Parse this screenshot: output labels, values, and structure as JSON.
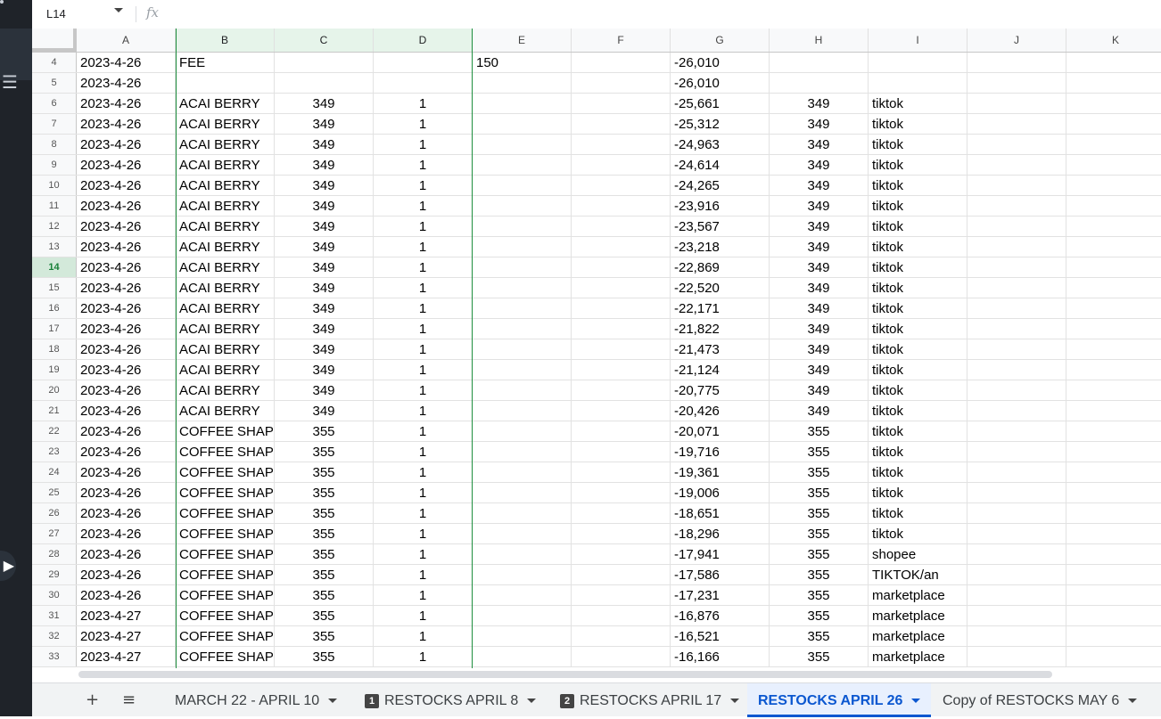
{
  "formula_bar": {
    "cell_ref": "L14",
    "fx_label": "fx"
  },
  "columns": [
    "A",
    "B",
    "C",
    "D",
    "E",
    "F",
    "G",
    "H",
    "I",
    "J",
    "K"
  ],
  "selected_columns": [
    "B",
    "C",
    "D"
  ],
  "selected_row": "14",
  "rows": [
    {
      "n": "4",
      "A": "2023-4-26",
      "B": "FEE",
      "C": "",
      "D": "",
      "E": "150",
      "F": "",
      "G": "-26,010",
      "H": "",
      "I": ""
    },
    {
      "n": "5",
      "A": "2023-4-26",
      "B": "",
      "C": "",
      "D": "",
      "E": "",
      "F": "",
      "G": "-26,010",
      "H": "",
      "I": ""
    },
    {
      "n": "6",
      "A": "2023-4-26",
      "B": "ACAI BERRY",
      "C": "349",
      "D": "1",
      "E": "",
      "F": "",
      "G": "-25,661",
      "H": "349",
      "I": "tiktok"
    },
    {
      "n": "7",
      "A": "2023-4-26",
      "B": "ACAI BERRY",
      "C": "349",
      "D": "1",
      "E": "",
      "F": "",
      "G": "-25,312",
      "H": "349",
      "I": "tiktok"
    },
    {
      "n": "8",
      "A": "2023-4-26",
      "B": "ACAI BERRY",
      "C": "349",
      "D": "1",
      "E": "",
      "F": "",
      "G": "-24,963",
      "H": "349",
      "I": "tiktok"
    },
    {
      "n": "9",
      "A": "2023-4-26",
      "B": "ACAI BERRY",
      "C": "349",
      "D": "1",
      "E": "",
      "F": "",
      "G": "-24,614",
      "H": "349",
      "I": "tiktok"
    },
    {
      "n": "10",
      "A": "2023-4-26",
      "B": "ACAI BERRY",
      "C": "349",
      "D": "1",
      "E": "",
      "F": "",
      "G": "-24,265",
      "H": "349",
      "I": "tiktok"
    },
    {
      "n": "11",
      "A": "2023-4-26",
      "B": "ACAI BERRY",
      "C": "349",
      "D": "1",
      "E": "",
      "F": "",
      "G": "-23,916",
      "H": "349",
      "I": "tiktok"
    },
    {
      "n": "12",
      "A": "2023-4-26",
      "B": "ACAI BERRY",
      "C": "349",
      "D": "1",
      "E": "",
      "F": "",
      "G": "-23,567",
      "H": "349",
      "I": "tiktok"
    },
    {
      "n": "13",
      "A": "2023-4-26",
      "B": "ACAI BERRY",
      "C": "349",
      "D": "1",
      "E": "",
      "F": "",
      "G": "-23,218",
      "H": "349",
      "I": "tiktok"
    },
    {
      "n": "14",
      "A": "2023-4-26",
      "B": "ACAI BERRY",
      "C": "349",
      "D": "1",
      "E": "",
      "F": "",
      "G": "-22,869",
      "H": "349",
      "I": "tiktok"
    },
    {
      "n": "15",
      "A": "2023-4-26",
      "B": "ACAI BERRY",
      "C": "349",
      "D": "1",
      "E": "",
      "F": "",
      "G": "-22,520",
      "H": "349",
      "I": "tiktok"
    },
    {
      "n": "16",
      "A": "2023-4-26",
      "B": "ACAI BERRY",
      "C": "349",
      "D": "1",
      "E": "",
      "F": "",
      "G": "-22,171",
      "H": "349",
      "I": "tiktok"
    },
    {
      "n": "17",
      "A": "2023-4-26",
      "B": "ACAI BERRY",
      "C": "349",
      "D": "1",
      "E": "",
      "F": "",
      "G": "-21,822",
      "H": "349",
      "I": "tiktok"
    },
    {
      "n": "18",
      "A": "2023-4-26",
      "B": "ACAI BERRY",
      "C": "349",
      "D": "1",
      "E": "",
      "F": "",
      "G": "-21,473",
      "H": "349",
      "I": "tiktok"
    },
    {
      "n": "19",
      "A": "2023-4-26",
      "B": "ACAI BERRY",
      "C": "349",
      "D": "1",
      "E": "",
      "F": "",
      "G": "-21,124",
      "H": "349",
      "I": "tiktok"
    },
    {
      "n": "20",
      "A": "2023-4-26",
      "B": "ACAI BERRY",
      "C": "349",
      "D": "1",
      "E": "",
      "F": "",
      "G": "-20,775",
      "H": "349",
      "I": "tiktok"
    },
    {
      "n": "21",
      "A": "2023-4-26",
      "B": "ACAI BERRY",
      "C": "349",
      "D": "1",
      "E": "",
      "F": "",
      "G": "-20,426",
      "H": "349",
      "I": "tiktok"
    },
    {
      "n": "22",
      "A": "2023-4-26",
      "B": " COFFEE SHAP",
      "C": "355",
      "D": "1",
      "E": "",
      "F": "",
      "G": "-20,071",
      "H": "355",
      "I": "tiktok"
    },
    {
      "n": "23",
      "A": "2023-4-26",
      "B": " COFFEE SHAP",
      "C": "355",
      "D": "1",
      "E": "",
      "F": "",
      "G": "-19,716",
      "H": "355",
      "I": "tiktok"
    },
    {
      "n": "24",
      "A": "2023-4-26",
      "B": " COFFEE SHAP",
      "C": "355",
      "D": "1",
      "E": "",
      "F": "",
      "G": "-19,361",
      "H": "355",
      "I": "tiktok"
    },
    {
      "n": "25",
      "A": "2023-4-26",
      "B": " COFFEE SHAP",
      "C": "355",
      "D": "1",
      "E": "",
      "F": "",
      "G": "-19,006",
      "H": "355",
      "I": "tiktok"
    },
    {
      "n": "26",
      "A": "2023-4-26",
      "B": " COFFEE SHAP",
      "C": "355",
      "D": "1",
      "E": "",
      "F": "",
      "G": "-18,651",
      "H": "355",
      "I": "tiktok"
    },
    {
      "n": "27",
      "A": "2023-4-26",
      "B": " COFFEE SHAP",
      "C": "355",
      "D": "1",
      "E": "",
      "F": "",
      "G": "-18,296",
      "H": "355",
      "I": "tiktok"
    },
    {
      "n": "28",
      "A": "2023-4-26",
      "B": " COFFEE SHAP",
      "C": "355",
      "D": "1",
      "E": "",
      "F": "",
      "G": "-17,941",
      "H": "355",
      "I": "shopee"
    },
    {
      "n": "29",
      "A": "2023-4-26",
      "B": " COFFEE SHAP",
      "C": "355",
      "D": "1",
      "E": "",
      "F": "",
      "G": "-17,586",
      "H": "355",
      "I": "TIKTOK/an"
    },
    {
      "n": "30",
      "A": "2023-4-26",
      "B": " COFFEE SHAP",
      "C": "355",
      "D": "1",
      "E": "",
      "F": "",
      "G": "-17,231",
      "H": "355",
      "I": "marketplace"
    },
    {
      "n": "31",
      "A": "2023-4-27",
      "B": " COFFEE SHAP",
      "C": "355",
      "D": "1",
      "E": "",
      "F": "",
      "G": "-16,876",
      "H": "355",
      "I": "marketplace"
    },
    {
      "n": "32",
      "A": "2023-4-27",
      "B": " COFFEE SHAP",
      "C": "355",
      "D": "1",
      "E": "",
      "F": "",
      "G": "-16,521",
      "H": "355",
      "I": "marketplace"
    },
    {
      "n": "33",
      "A": "2023-4-27",
      "B": " COFFEE SHAP",
      "C": "355",
      "D": "1",
      "E": "",
      "F": "",
      "G": "-16,166",
      "H": "355",
      "I": "marketplace"
    }
  ],
  "tabbar": {
    "add_label": "+",
    "menu_label": "≡",
    "tabs": [
      {
        "label": "MARCH 22 - APRIL 10",
        "badge": "",
        "active": false
      },
      {
        "label": "RESTOCKS APRIL 8",
        "badge": "1",
        "active": false
      },
      {
        "label": "RESTOCKS APRIL 17",
        "badge": "2",
        "active": false
      },
      {
        "label": "RESTOCKS APRIL 26",
        "badge": "",
        "active": true
      },
      {
        "label": "Copy of RESTOCKS MAY 6",
        "badge": "",
        "active": false
      }
    ]
  },
  "colors": {
    "selection_green": "#1e8e3e",
    "active_tab_blue": "#0b57d0"
  }
}
